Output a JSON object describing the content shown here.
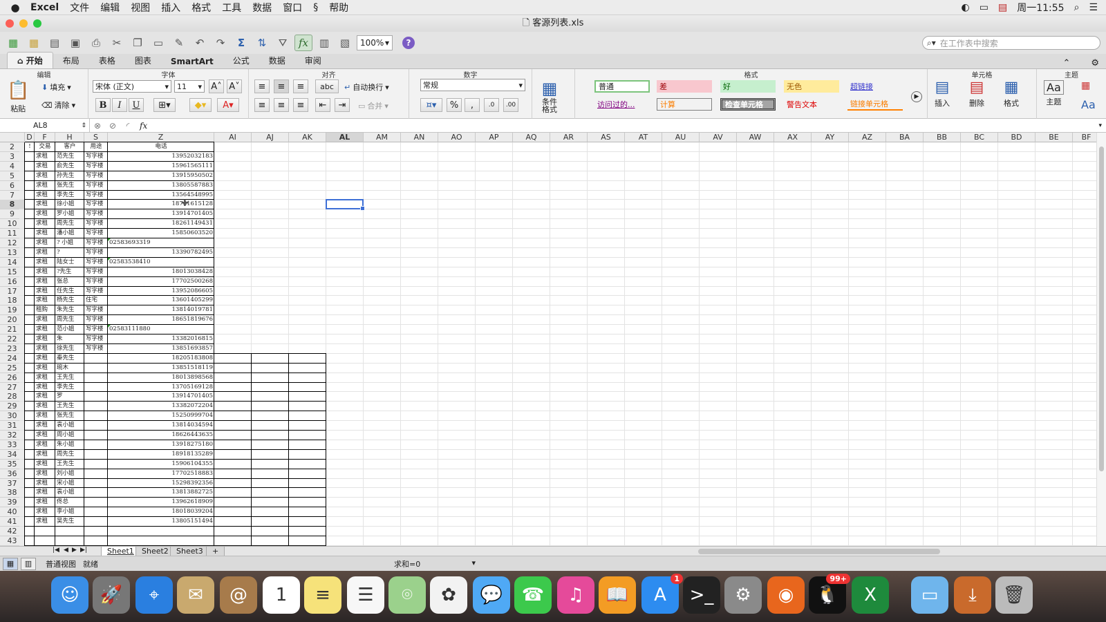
{
  "menubar": {
    "app": "Excel",
    "items": [
      "文件",
      "编辑",
      "视图",
      "插入",
      "格式",
      "工具",
      "数据",
      "窗口",
      "帮助"
    ],
    "clock": "周一11:55"
  },
  "window": {
    "title": "客源列表.xls"
  },
  "toolbar": {
    "zoom": "100%",
    "search_placeholder": "在工作表中搜索"
  },
  "ribbon_tabs": [
    "开始",
    "布局",
    "表格",
    "图表",
    "SmartArt",
    "公式",
    "数据",
    "审阅"
  ],
  "ribbon": {
    "groups": {
      "edit": "编辑",
      "font": "字体",
      "align": "对齐",
      "number": "数字",
      "format": "格式",
      "cells": "单元格",
      "theme": "主题"
    },
    "paste": "粘贴",
    "fill": "填充",
    "clear": "清除",
    "font_name": "宋体 (正文)",
    "font_size": "11",
    "wrap": "自动换行",
    "merge": "合并",
    "number_format": "常规",
    "cond_format": "条件格式",
    "styles": [
      "普通",
      "差",
      "好",
      "无色",
      "超链接",
      "访问过的...",
      "计算",
      "检查单元格",
      "警告文本",
      "链接单元格"
    ],
    "insert": "插入",
    "delete": "删除",
    "format_btn": "格式",
    "theme": "主题",
    "abc": "abc",
    "dec_inc": ".0",
    "dec_dec": ".00"
  },
  "formula": {
    "namebox": "AL8",
    "content": ""
  },
  "columns": [
    {
      "id": "D",
      "w": 14
    },
    {
      "id": "F",
      "w": 30
    },
    {
      "id": "H",
      "w": 42
    },
    {
      "id": "S",
      "w": 34
    },
    {
      "id": "Z",
      "w": 154
    },
    {
      "id": "AI",
      "w": 54
    },
    {
      "id": "AJ",
      "w": 54
    },
    {
      "id": "AK",
      "w": 54
    },
    {
      "id": "AL",
      "w": 54
    },
    {
      "id": "AM",
      "w": 54
    },
    {
      "id": "AN",
      "w": 54
    },
    {
      "id": "AO",
      "w": 54
    },
    {
      "id": "AP",
      "w": 54
    },
    {
      "id": "AQ",
      "w": 54
    },
    {
      "id": "AR",
      "w": 54
    },
    {
      "id": "AS",
      "w": 54
    },
    {
      "id": "AT",
      "w": 54
    },
    {
      "id": "AU",
      "w": 54
    },
    {
      "id": "AV",
      "w": 54
    },
    {
      "id": "AW",
      "w": 54
    },
    {
      "id": "AX",
      "w": 54
    },
    {
      "id": "AY",
      "w": 54
    },
    {
      "id": "AZ",
      "w": 54
    },
    {
      "id": "BA",
      "w": 54
    },
    {
      "id": "BB",
      "w": 54
    },
    {
      "id": "BC",
      "w": 54
    },
    {
      "id": "BD",
      "w": 54
    },
    {
      "id": "BE",
      "w": 54
    },
    {
      "id": "BF",
      "w": 40
    }
  ],
  "selected": {
    "col": "AL",
    "row": 8
  },
  "header_row": {
    "row": 2,
    "cells": [
      "!",
      "交易",
      "客户",
      "用途",
      "电话"
    ]
  },
  "rows": [
    {
      "r": 3,
      "f": "求租",
      "h": "范先生",
      "s": "写字楼",
      "z": "13952032183"
    },
    {
      "r": 4,
      "f": "求租",
      "h": "俞先生",
      "s": "写字楼",
      "z": "15961565111"
    },
    {
      "r": 5,
      "f": "求租",
      "h": "孙先生",
      "s": "写字楼",
      "z": "13915950502"
    },
    {
      "r": 6,
      "f": "求租",
      "h": "张先生",
      "s": "写字楼",
      "z": "13805587883"
    },
    {
      "r": 7,
      "f": "求租",
      "h": "李先生",
      "s": "写字楼",
      "z": "13564548995"
    },
    {
      "r": 8,
      "f": "求租",
      "h": "徐小姐",
      "s": "写字楼",
      "z": "18761615128"
    },
    {
      "r": 9,
      "f": "求租",
      "h": "罗小姐",
      "s": "写字楼",
      "z": "13914701405"
    },
    {
      "r": 10,
      "f": "求租",
      "h": "周先生",
      "s": "写字楼",
      "z": "18261149431"
    },
    {
      "r": 11,
      "f": "求租",
      "h": "潘小姐",
      "s": "写字楼",
      "z": "15850603520"
    },
    {
      "r": 12,
      "f": "求租",
      "h": "? 小姐",
      "s": "写字楼",
      "z": "02583693319",
      "text": true
    },
    {
      "r": 13,
      "f": "求租",
      "h": "?",
      "s": "写字楼",
      "z": "13390782495"
    },
    {
      "r": 14,
      "f": "求租",
      "h": "陆女士",
      "s": "写字楼",
      "z": "02583538410",
      "text": true
    },
    {
      "r": 15,
      "f": "求租",
      "h": "?先生",
      "s": "写字楼",
      "z": "18013038428"
    },
    {
      "r": 16,
      "f": "求租",
      "h": "张总",
      "s": "写字楼",
      "z": "17702500268"
    },
    {
      "r": 17,
      "f": "求租",
      "h": "任先生",
      "s": "写字楼",
      "z": "13952086605"
    },
    {
      "r": 18,
      "f": "求租",
      "h": "杨先生",
      "s": "住宅",
      "z": "13601405299"
    },
    {
      "r": 19,
      "f": "租购",
      "h": "朱先生",
      "s": "写字楼",
      "z": "13814019781"
    },
    {
      "r": 20,
      "f": "求租",
      "h": "周先生",
      "s": "写字楼",
      "z": "18651819676"
    },
    {
      "r": 21,
      "f": "求租",
      "h": "范小姐",
      "s": "写字楼",
      "z": "02583111880",
      "text": true
    },
    {
      "r": 22,
      "f": "求租",
      "h": "朱",
      "s": "写字楼",
      "z": "13382016815"
    },
    {
      "r": 23,
      "f": "求租",
      "h": "徐先生",
      "s": "写字楼",
      "z": "13851693857"
    },
    {
      "r": 24,
      "f": "求租",
      "h": "秦先生",
      "s": "",
      "z": "18205183808"
    },
    {
      "r": 25,
      "f": "求租",
      "h": "琬木",
      "s": "",
      "z": "13851518119"
    },
    {
      "r": 26,
      "f": "求租",
      "h": "王先生",
      "s": "",
      "z": "18013898568"
    },
    {
      "r": 27,
      "f": "求租",
      "h": "李先生",
      "s": "",
      "z": "13705169128"
    },
    {
      "r": 28,
      "f": "求租",
      "h": "罗",
      "s": "",
      "z": "13914701405"
    },
    {
      "r": 29,
      "f": "求租",
      "h": "王先生",
      "s": "",
      "z": "13382072204"
    },
    {
      "r": 30,
      "f": "求租",
      "h": "张先生",
      "s": "",
      "z": "15250999704"
    },
    {
      "r": 31,
      "f": "求租",
      "h": "袁小姐",
      "s": "",
      "z": "13814034594"
    },
    {
      "r": 32,
      "f": "求租",
      "h": "周小姐",
      "s": "",
      "z": "18626443635"
    },
    {
      "r": 33,
      "f": "求租",
      "h": "朱小姐",
      "s": "",
      "z": "13918275180"
    },
    {
      "r": 34,
      "f": "求租",
      "h": "周先生",
      "s": "",
      "z": "18918135289"
    },
    {
      "r": 35,
      "f": "求租",
      "h": "王先生",
      "s": "",
      "z": "15906104355"
    },
    {
      "r": 36,
      "f": "求租",
      "h": "刘小姐",
      "s": "",
      "z": "17702518883"
    },
    {
      "r": 37,
      "f": "求租",
      "h": "宋小姐",
      "s": "",
      "z": "15298392356"
    },
    {
      "r": 38,
      "f": "求租",
      "h": "袁小姐",
      "s": "",
      "z": "13813882725"
    },
    {
      "r": 39,
      "f": "求租",
      "h": "佟总",
      "s": "",
      "z": "13962618909"
    },
    {
      "r": 40,
      "f": "求租",
      "h": "李小姐",
      "s": "",
      "z": "18018039204"
    },
    {
      "r": 41,
      "f": "求租",
      "h": "吴先生",
      "s": "",
      "z": "13805151494"
    }
  ],
  "extra_rows": [
    42,
    43
  ],
  "sheets": [
    "Sheet1",
    "Sheet2",
    "Sheet3"
  ],
  "active_sheet": "Sheet1",
  "status": {
    "view": "普通视图",
    "ready": "就绪",
    "sum": "求和=0"
  },
  "dock": [
    {
      "name": "finder-icon",
      "color": "#3a8ee6",
      "glyph": "☺"
    },
    {
      "name": "launchpad-icon",
      "color": "#777",
      "glyph": "🚀"
    },
    {
      "name": "safari-icon",
      "color": "#2a7fe0",
      "glyph": "⌖"
    },
    {
      "name": "mail-icon",
      "color": "#c9a96e",
      "glyph": "✉"
    },
    {
      "name": "contacts-icon",
      "color": "#a77b4b",
      "glyph": "@"
    },
    {
      "name": "calendar-icon",
      "color": "#fff",
      "glyph": "1"
    },
    {
      "name": "notes-icon",
      "color": "#f6e27a",
      "glyph": "≡"
    },
    {
      "name": "reminders-icon",
      "color": "#f7f7f7",
      "glyph": "☰"
    },
    {
      "name": "maps-icon",
      "color": "#9bd18c",
      "glyph": "⌾"
    },
    {
      "name": "photos-icon",
      "color": "#f2f2f2",
      "glyph": "✿"
    },
    {
      "name": "messages-icon",
      "color": "#4fa9f5",
      "glyph": "💬"
    },
    {
      "name": "facetime-icon",
      "color": "#3cc94c",
      "glyph": "☎"
    },
    {
      "name": "itunes-icon",
      "color": "#e54a9a",
      "glyph": "♫"
    },
    {
      "name": "ibooks-icon",
      "color": "#f39c24",
      "glyph": "📖"
    },
    {
      "name": "appstore-icon",
      "color": "#2d8cf0",
      "glyph": "A",
      "badge": "1"
    },
    {
      "name": "terminal-icon",
      "color": "#222",
      "glyph": ">_"
    },
    {
      "name": "system-prefs-icon",
      "color": "#8a8a8a",
      "glyph": "⚙"
    },
    {
      "name": "firefox-icon",
      "color": "#e8661d",
      "glyph": "◉"
    },
    {
      "name": "qq-icon",
      "color": "#111",
      "glyph": "🐧",
      "badge": "99+"
    },
    {
      "name": "excel-icon",
      "color": "#1e8a3c",
      "glyph": "X"
    },
    {
      "name": "folder-icon",
      "color": "#6fb5ec",
      "glyph": "▭"
    },
    {
      "name": "downloads-icon",
      "color": "#c96a2c",
      "glyph": "⤓"
    },
    {
      "name": "trash-icon",
      "color": "#bbb",
      "glyph": "🗑"
    }
  ]
}
